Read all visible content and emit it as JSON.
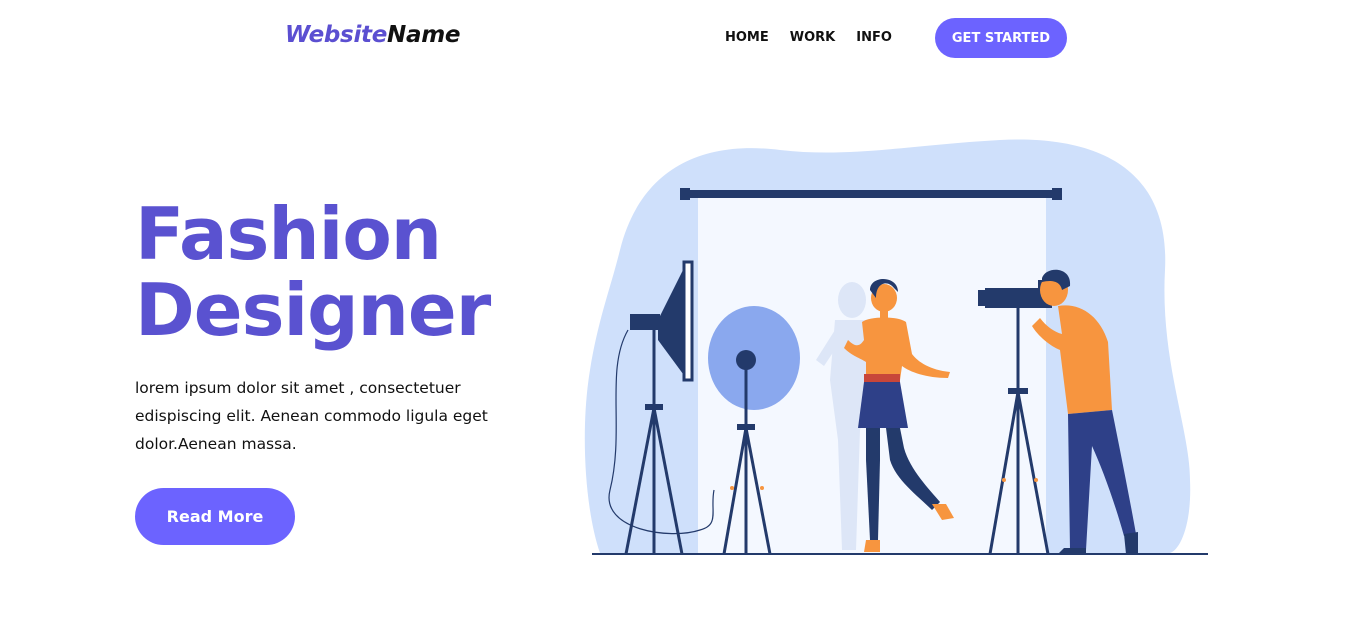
{
  "header": {
    "logo": {
      "part1": "Website",
      "part2": "Name"
    },
    "nav": [
      {
        "label": "HOME"
      },
      {
        "label": "WORK"
      },
      {
        "label": "INFO"
      }
    ],
    "cta_label": "GET STARTED"
  },
  "hero": {
    "title_line1": "Fashion",
    "title_line2": "Designer",
    "description": "lorem ipsum dolor sit amet , consectetuer edispiscing elit. Aenean commodo ligula eget dolor.Aenean massa.",
    "button_label": "Read More"
  },
  "colors": {
    "accent": "#6c63ff",
    "title": "#5a52d0",
    "blob": "#cfe0fb",
    "navy": "#233a6b",
    "orange": "#f7953f"
  },
  "illustration": {
    "name": "photo-studio-illustration"
  }
}
